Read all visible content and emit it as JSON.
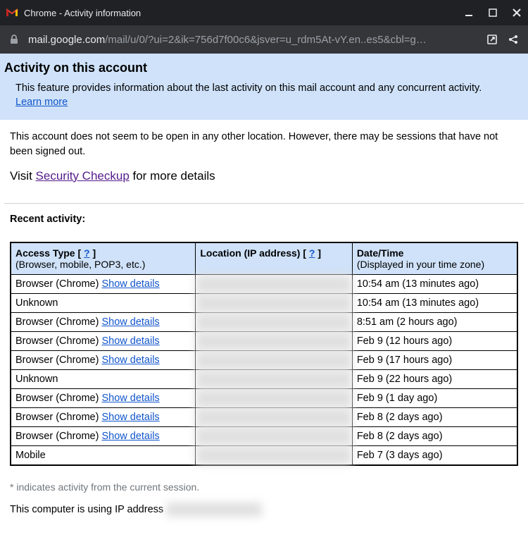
{
  "window": {
    "title": "Chrome - Activity information"
  },
  "address": {
    "host": "mail.google.com",
    "path": "/mail/u/0/?ui=2&ik=756d7f00c6&jsver=u_rdm5At-vY.en..es5&cbl=g…"
  },
  "banner": {
    "heading": "Activity on this account",
    "description": "This feature provides information about the last activity on this mail account and any concurrent activity.",
    "learn_more": "Learn more"
  },
  "status": "This account does not seem to be open in any other location. However, there may be sessions that have not been signed out.",
  "visit": {
    "prefix": "Visit ",
    "link": "Security Checkup",
    "suffix": " for more details"
  },
  "recent_label": "Recent activity:",
  "headers": {
    "access": "Access Type [ ",
    "access_help": "?",
    "access_close": " ]",
    "access_sub": "(Browser, mobile, POP3, etc.)",
    "location": "Location (IP address) [ ",
    "location_help": "?",
    "location_close": " ]",
    "date": "Date/Time",
    "date_sub": "(Displayed in your time zone)"
  },
  "show_details": "Show details",
  "rows": [
    {
      "access": "Browser (Chrome) ",
      "has_details": true,
      "location": "redacted",
      "date": "10:54 am (13 minutes ago)"
    },
    {
      "access": "Unknown",
      "has_details": false,
      "location": "redacted",
      "date": "10:54 am (13 minutes ago)"
    },
    {
      "access": "Browser (Chrome) ",
      "has_details": true,
      "location": "redacted",
      "date": "8:51 am (2 hours ago)"
    },
    {
      "access": "Browser (Chrome) ",
      "has_details": true,
      "location": "redacted",
      "date": "Feb 9 (12 hours ago)"
    },
    {
      "access": "Browser (Chrome) ",
      "has_details": true,
      "location": "redacted",
      "date": "Feb 9 (17 hours ago)"
    },
    {
      "access": "Unknown",
      "has_details": false,
      "location": "redacted",
      "date": "Feb 9 (22 hours ago)"
    },
    {
      "access": "Browser (Chrome) ",
      "has_details": true,
      "location": "redacted",
      "date": "Feb 9 (1 day ago)"
    },
    {
      "access": "Browser (Chrome) ",
      "has_details": true,
      "location": "redacted",
      "date": "Feb 8 (2 days ago)"
    },
    {
      "access": "Browser (Chrome) ",
      "has_details": true,
      "location": "redacted",
      "date": "Feb 8 (2 days ago)"
    },
    {
      "access": "Mobile",
      "has_details": false,
      "location": "redacted",
      "date": "Feb 7 (3 days ago)"
    }
  ],
  "footnote": "* indicates activity from the current session.",
  "ip_line": {
    "prefix": "This computer is using IP address ",
    "value": "redacted ip address"
  }
}
